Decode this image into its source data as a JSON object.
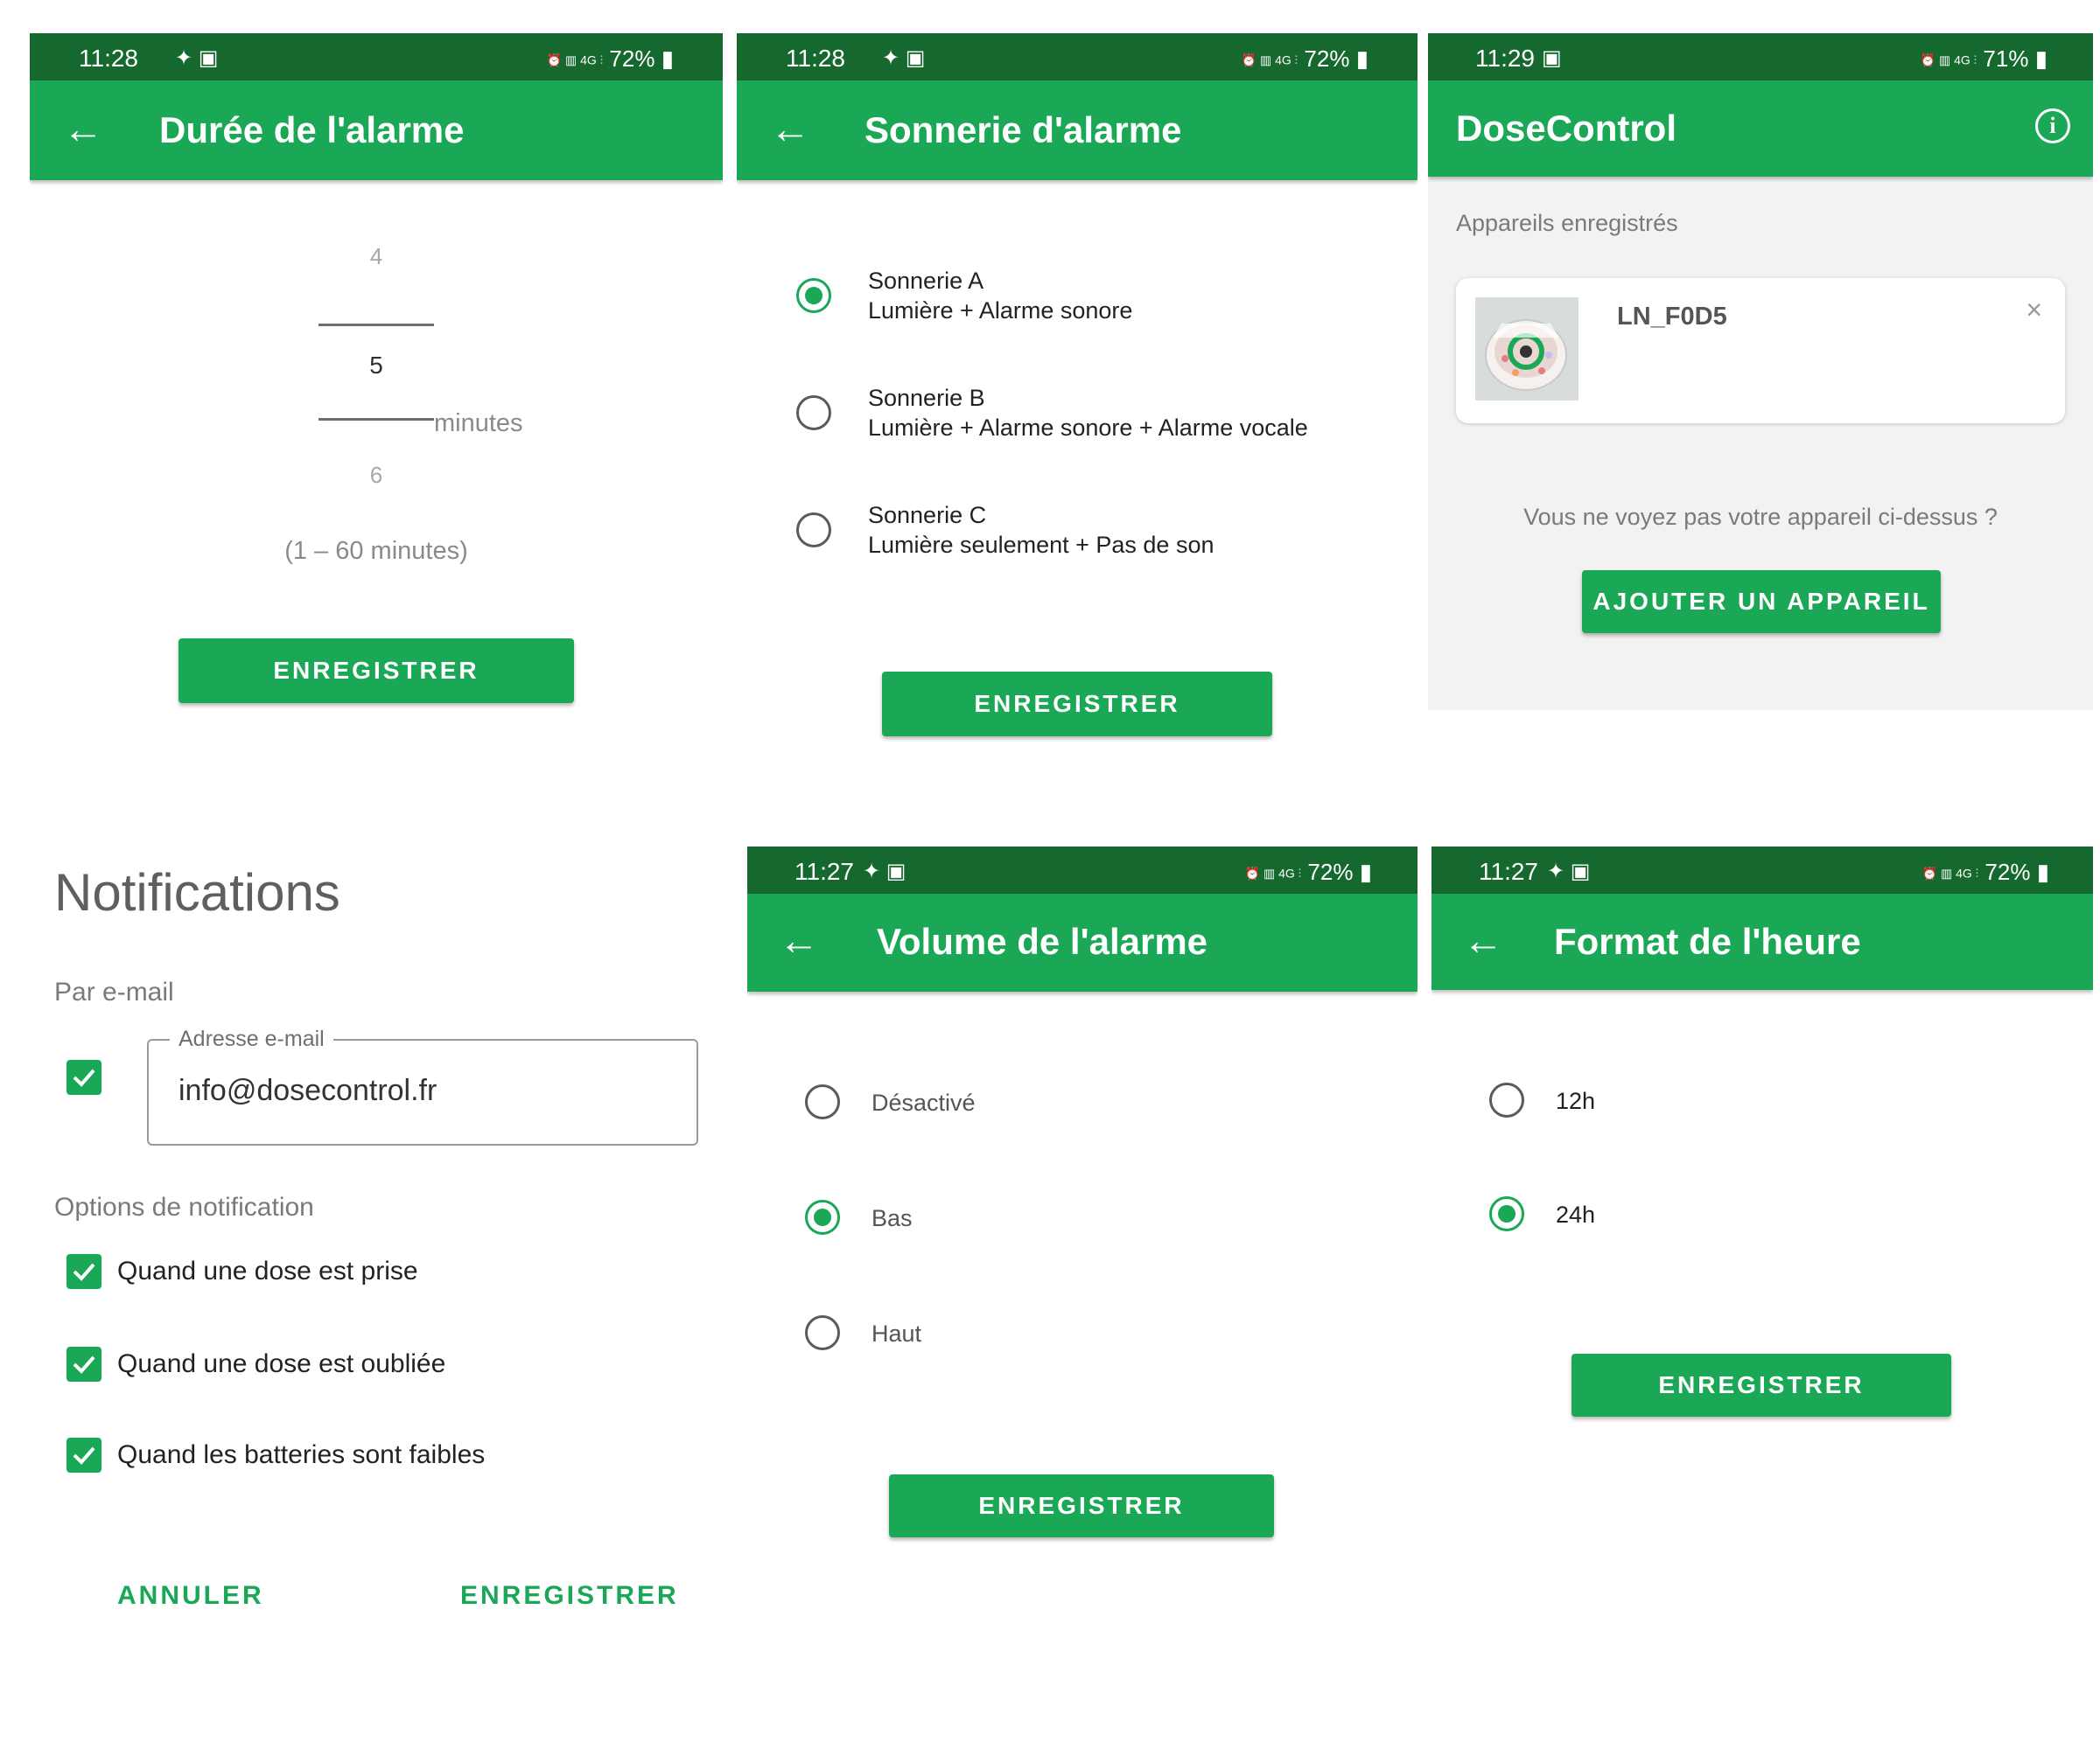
{
  "screens": {
    "duration": {
      "status": {
        "time": "11:28",
        "battery": "72%"
      },
      "title": "Durée de l'alarme",
      "picker": {
        "prev": "4",
        "current": "5",
        "next": "6",
        "unit": "minutes",
        "range": "(1 – 60 minutes)"
      },
      "save_label": "ENREGISTRER"
    },
    "ringtone": {
      "status": {
        "time": "11:28",
        "battery": "72%"
      },
      "title": "Sonnerie d'alarme",
      "options": [
        {
          "name": "Sonnerie A",
          "desc": "Lumière + Alarme sonore",
          "selected": true
        },
        {
          "name": "Sonnerie B",
          "desc": "Lumière + Alarme sonore + Alarme vocale",
          "selected": false
        },
        {
          "name": "Sonnerie C",
          "desc": "Lumière seulement + Pas de son",
          "selected": false
        }
      ],
      "save_label": "ENREGISTRER"
    },
    "devices": {
      "status": {
        "time": "11:29",
        "battery": "71%"
      },
      "title": "DoseControl",
      "section_label": "Appareils enregistrés",
      "device_name": "LN_F0D5",
      "missing_text": "Vous ne voyez pas votre appareil ci-dessus ?",
      "add_label": "AJOUTER UN APPAREIL"
    },
    "notifications": {
      "title": "Notifications",
      "email_section": "Par e-mail",
      "email_field_label": "Adresse e-mail",
      "email_value": "info@dosecontrol.fr",
      "options_section": "Options de notification",
      "options": [
        "Quand une dose est prise",
        "Quand une dose est oubliée",
        "Quand les batteries sont faibles"
      ],
      "cancel_label": "ANNULER",
      "save_label": "ENREGISTRER"
    },
    "volume": {
      "status": {
        "time": "11:27",
        "battery": "72%"
      },
      "title": "Volume de l'alarme",
      "options": [
        {
          "label": "Désactivé",
          "selected": false
        },
        {
          "label": "Bas",
          "selected": true
        },
        {
          "label": "Haut",
          "selected": false
        }
      ],
      "save_label": "ENREGISTRER"
    },
    "timeformat": {
      "status": {
        "time": "11:27",
        "battery": "72%"
      },
      "title": "Format de l'heure",
      "options": [
        {
          "label": "12h",
          "selected": false
        },
        {
          "label": "24h",
          "selected": true
        }
      ],
      "save_label": "ENREGISTRER"
    }
  },
  "status_icons": {
    "left": "✦ ▣",
    "right": "⏰ ▥ 4G ⫶"
  },
  "colors": {
    "primary": "#1ba856",
    "status_bar": "#16692e",
    "card_bg": "#f2f2f2"
  }
}
